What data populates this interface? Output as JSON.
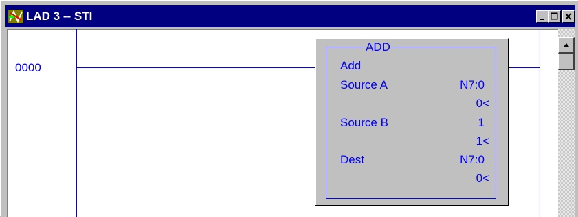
{
  "window": {
    "title": "LAD 3 -- STI",
    "icon": "ladder-file-icon",
    "controls": [
      "minimize-icon",
      "maximize-icon",
      "close-icon"
    ]
  },
  "ladder": {
    "rung_number": "0000"
  },
  "instruction": {
    "mnemonic": "ADD",
    "description": "Add",
    "source_a": {
      "label": "Source A",
      "address": "N7:0",
      "value": "0<"
    },
    "source_b": {
      "label": "Source B",
      "address": "1",
      "value": "1<"
    },
    "dest": {
      "label": "Dest",
      "address": "N7:0",
      "value": "0<"
    }
  },
  "colors": {
    "titlebar": "#000080",
    "ladder_ink": "#0000ff",
    "face": "#c0c0c0"
  }
}
